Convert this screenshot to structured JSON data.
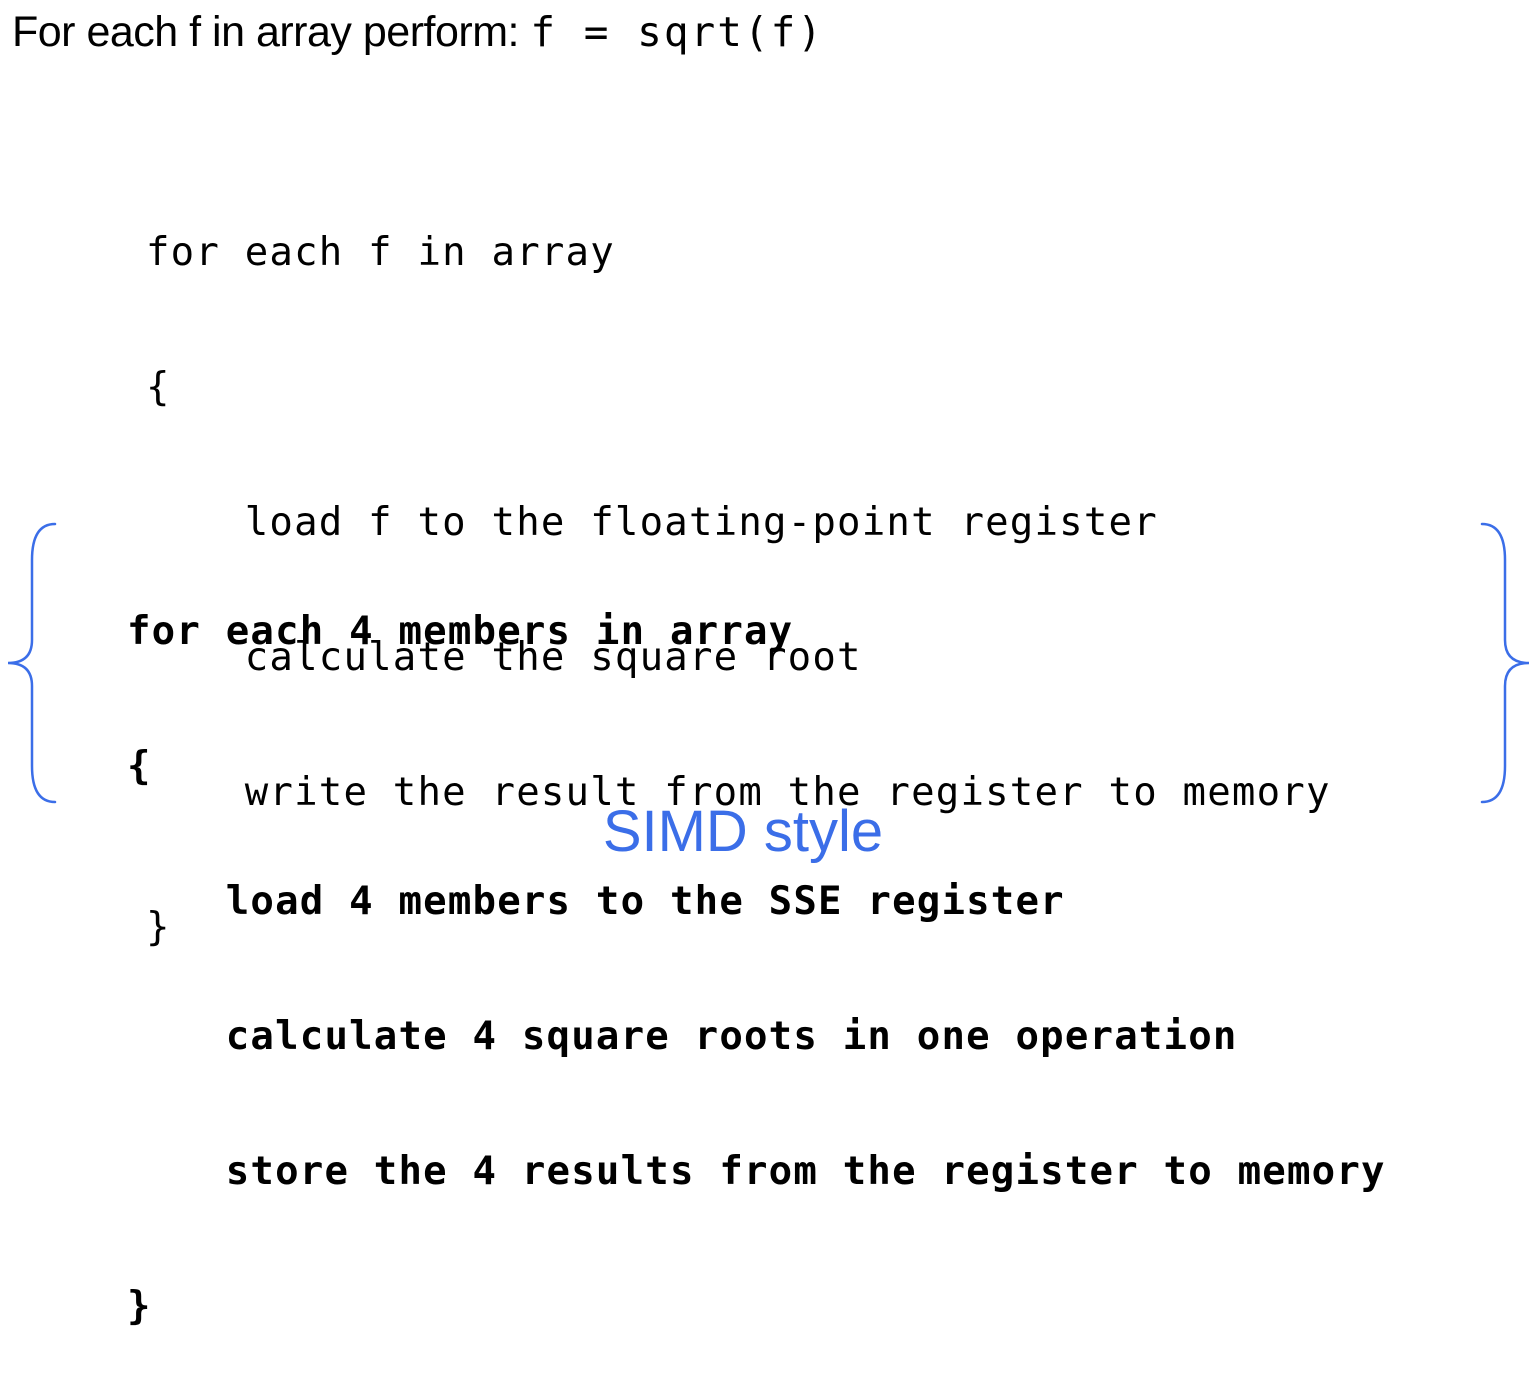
{
  "header": {
    "prefix": "For each f in array perform: ",
    "formula": "f = sqrt(f)"
  },
  "scalar_code": {
    "lines": [
      "for each f in array",
      "{",
      "    load f to the floating-point register",
      "    calculate the square root",
      "    write the result from the register to memory",
      "}"
    ]
  },
  "simd_code": {
    "lines": [
      "for each 4 members in array",
      "{",
      "    load 4 members to the SSE register",
      "    calculate 4 square roots in one operation",
      "    store the 4 results from the register to memory",
      "}"
    ]
  },
  "caption": "SIMD style",
  "colors": {
    "accent": "#3b6ee8",
    "text": "#000000",
    "background": "#ffffff"
  }
}
